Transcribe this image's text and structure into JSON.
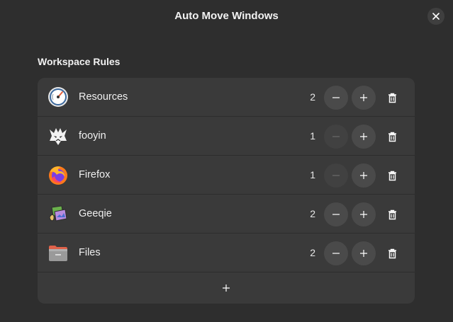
{
  "window": {
    "title": "Auto Move Windows"
  },
  "section": {
    "title": "Workspace Rules"
  },
  "rules": [
    {
      "app": "Resources",
      "icon": "resources-icon",
      "workspace": "2",
      "minus_enabled": true
    },
    {
      "app": "fooyin",
      "icon": "fooyin-icon",
      "workspace": "1",
      "minus_enabled": false
    },
    {
      "app": "Firefox",
      "icon": "firefox-icon",
      "workspace": "1",
      "minus_enabled": false
    },
    {
      "app": "Geeqie",
      "icon": "geeqie-icon",
      "workspace": "2",
      "minus_enabled": true
    },
    {
      "app": "Files",
      "icon": "files-icon",
      "workspace": "2",
      "minus_enabled": true
    }
  ],
  "colors": {
    "background": "#2e2e2e",
    "card": "#3a3a3a",
    "button": "#4a4a4a",
    "text": "#f0f0f0"
  }
}
